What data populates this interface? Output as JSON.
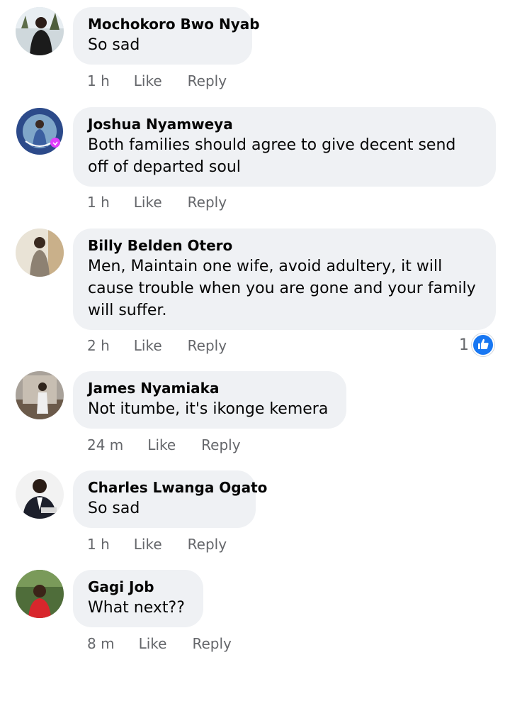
{
  "comments": [
    {
      "author": "Mochokoro Bwo Nyab",
      "text": "So sad",
      "time": "1 h",
      "like_label": "Like",
      "reply_label": "Reply",
      "avatar": "avatar-photo"
    },
    {
      "author": "Joshua Nyamweya",
      "text": "Both families should agree to give decent send off of departed soul",
      "time": "1 h",
      "like_label": "Like",
      "reply_label": "Reply",
      "avatar": "avatar-photo-with-vaccine-frame"
    },
    {
      "author": "Billy Belden Otero",
      "text": "Men, Maintain one wife, avoid adultery, it will cause trouble when you are gone and your family will suffer.",
      "time": "2 h",
      "like_label": "Like",
      "reply_label": "Reply",
      "reaction_count": "1",
      "reaction_icon": "thumbs-up-icon",
      "avatar": "avatar-photo"
    },
    {
      "author": "James Nyamiaka",
      "text": "Not itumbe, it's ikonge kemera",
      "time": "24 m",
      "like_label": "Like",
      "reply_label": "Reply",
      "avatar": "avatar-photo"
    },
    {
      "author": "Charles Lwanga Ogato",
      "text": "So sad",
      "time": "1 h",
      "like_label": "Like",
      "reply_label": "Reply",
      "avatar": "avatar-photo"
    },
    {
      "author": "Gagi Job",
      "text": "What next??",
      "time": "8 m",
      "like_label": "Like",
      "reply_label": "Reply",
      "avatar": "avatar-photo"
    }
  ],
  "colors": {
    "bubble_background": "#eff1f4",
    "meta_text": "#65676b",
    "like_blue": "#1877f2"
  }
}
